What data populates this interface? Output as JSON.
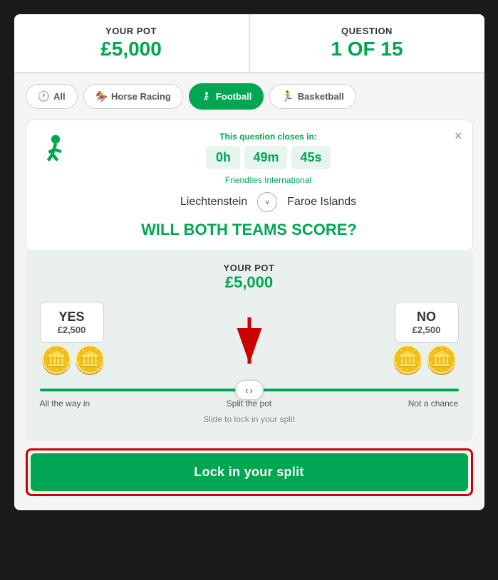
{
  "header": {
    "pot_label": "YOUR POT",
    "pot_value": "£5,000",
    "question_label": "QUESTION",
    "question_value": "1 OF 15"
  },
  "tabs": [
    {
      "id": "all",
      "label": "All",
      "icon": "clock",
      "active": false
    },
    {
      "id": "horse-racing",
      "label": "Horse Racing",
      "icon": "horse",
      "active": false
    },
    {
      "id": "football",
      "label": "Football",
      "icon": "football",
      "active": true
    },
    {
      "id": "basketball",
      "label": "Basketball",
      "icon": "basketball",
      "active": false
    }
  ],
  "question_card": {
    "close_label": "×",
    "countdown_label": "This question closes in:",
    "hours": "0h",
    "minutes": "49m",
    "seconds": "45s",
    "league": "Friendlies International",
    "team_home": "Liechtenstein",
    "vs": "v",
    "team_away": "Faroe Islands",
    "question": "WILL BOTH TEAMS SCORE?"
  },
  "bet_area": {
    "pot_label": "YOUR POT",
    "pot_value": "£5,000",
    "yes_label": "YES",
    "yes_amount": "£2,500",
    "no_label": "NO",
    "no_amount": "£2,500",
    "label_left": "All the way in",
    "label_center": "Split the pot",
    "label_right": "Not a chance",
    "slide_hint": "Slide to lock in your split",
    "lock_btn_label": "Lock in your split"
  }
}
